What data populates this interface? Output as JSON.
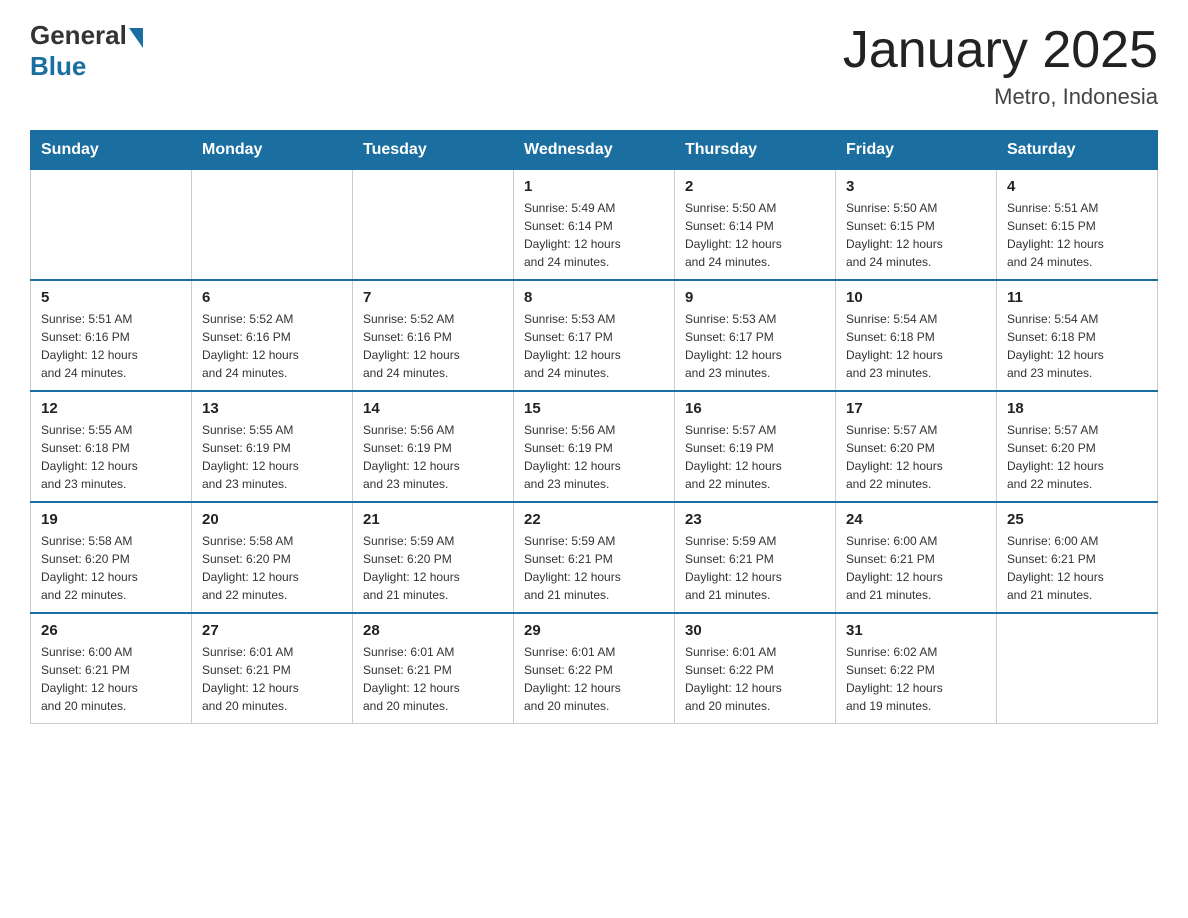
{
  "header": {
    "title": "January 2025",
    "location": "Metro, Indonesia"
  },
  "logo": {
    "general": "General",
    "blue": "Blue"
  },
  "days": [
    "Sunday",
    "Monday",
    "Tuesday",
    "Wednesday",
    "Thursday",
    "Friday",
    "Saturday"
  ],
  "weeks": [
    [
      {
        "num": "",
        "info": ""
      },
      {
        "num": "",
        "info": ""
      },
      {
        "num": "",
        "info": ""
      },
      {
        "num": "1",
        "info": "Sunrise: 5:49 AM\nSunset: 6:14 PM\nDaylight: 12 hours\nand 24 minutes."
      },
      {
        "num": "2",
        "info": "Sunrise: 5:50 AM\nSunset: 6:14 PM\nDaylight: 12 hours\nand 24 minutes."
      },
      {
        "num": "3",
        "info": "Sunrise: 5:50 AM\nSunset: 6:15 PM\nDaylight: 12 hours\nand 24 minutes."
      },
      {
        "num": "4",
        "info": "Sunrise: 5:51 AM\nSunset: 6:15 PM\nDaylight: 12 hours\nand 24 minutes."
      }
    ],
    [
      {
        "num": "5",
        "info": "Sunrise: 5:51 AM\nSunset: 6:16 PM\nDaylight: 12 hours\nand 24 minutes."
      },
      {
        "num": "6",
        "info": "Sunrise: 5:52 AM\nSunset: 6:16 PM\nDaylight: 12 hours\nand 24 minutes."
      },
      {
        "num": "7",
        "info": "Sunrise: 5:52 AM\nSunset: 6:16 PM\nDaylight: 12 hours\nand 24 minutes."
      },
      {
        "num": "8",
        "info": "Sunrise: 5:53 AM\nSunset: 6:17 PM\nDaylight: 12 hours\nand 24 minutes."
      },
      {
        "num": "9",
        "info": "Sunrise: 5:53 AM\nSunset: 6:17 PM\nDaylight: 12 hours\nand 23 minutes."
      },
      {
        "num": "10",
        "info": "Sunrise: 5:54 AM\nSunset: 6:18 PM\nDaylight: 12 hours\nand 23 minutes."
      },
      {
        "num": "11",
        "info": "Sunrise: 5:54 AM\nSunset: 6:18 PM\nDaylight: 12 hours\nand 23 minutes."
      }
    ],
    [
      {
        "num": "12",
        "info": "Sunrise: 5:55 AM\nSunset: 6:18 PM\nDaylight: 12 hours\nand 23 minutes."
      },
      {
        "num": "13",
        "info": "Sunrise: 5:55 AM\nSunset: 6:19 PM\nDaylight: 12 hours\nand 23 minutes."
      },
      {
        "num": "14",
        "info": "Sunrise: 5:56 AM\nSunset: 6:19 PM\nDaylight: 12 hours\nand 23 minutes."
      },
      {
        "num": "15",
        "info": "Sunrise: 5:56 AM\nSunset: 6:19 PM\nDaylight: 12 hours\nand 23 minutes."
      },
      {
        "num": "16",
        "info": "Sunrise: 5:57 AM\nSunset: 6:19 PM\nDaylight: 12 hours\nand 22 minutes."
      },
      {
        "num": "17",
        "info": "Sunrise: 5:57 AM\nSunset: 6:20 PM\nDaylight: 12 hours\nand 22 minutes."
      },
      {
        "num": "18",
        "info": "Sunrise: 5:57 AM\nSunset: 6:20 PM\nDaylight: 12 hours\nand 22 minutes."
      }
    ],
    [
      {
        "num": "19",
        "info": "Sunrise: 5:58 AM\nSunset: 6:20 PM\nDaylight: 12 hours\nand 22 minutes."
      },
      {
        "num": "20",
        "info": "Sunrise: 5:58 AM\nSunset: 6:20 PM\nDaylight: 12 hours\nand 22 minutes."
      },
      {
        "num": "21",
        "info": "Sunrise: 5:59 AM\nSunset: 6:20 PM\nDaylight: 12 hours\nand 21 minutes."
      },
      {
        "num": "22",
        "info": "Sunrise: 5:59 AM\nSunset: 6:21 PM\nDaylight: 12 hours\nand 21 minutes."
      },
      {
        "num": "23",
        "info": "Sunrise: 5:59 AM\nSunset: 6:21 PM\nDaylight: 12 hours\nand 21 minutes."
      },
      {
        "num": "24",
        "info": "Sunrise: 6:00 AM\nSunset: 6:21 PM\nDaylight: 12 hours\nand 21 minutes."
      },
      {
        "num": "25",
        "info": "Sunrise: 6:00 AM\nSunset: 6:21 PM\nDaylight: 12 hours\nand 21 minutes."
      }
    ],
    [
      {
        "num": "26",
        "info": "Sunrise: 6:00 AM\nSunset: 6:21 PM\nDaylight: 12 hours\nand 20 minutes."
      },
      {
        "num": "27",
        "info": "Sunrise: 6:01 AM\nSunset: 6:21 PM\nDaylight: 12 hours\nand 20 minutes."
      },
      {
        "num": "28",
        "info": "Sunrise: 6:01 AM\nSunset: 6:21 PM\nDaylight: 12 hours\nand 20 minutes."
      },
      {
        "num": "29",
        "info": "Sunrise: 6:01 AM\nSunset: 6:22 PM\nDaylight: 12 hours\nand 20 minutes."
      },
      {
        "num": "30",
        "info": "Sunrise: 6:01 AM\nSunset: 6:22 PM\nDaylight: 12 hours\nand 20 minutes."
      },
      {
        "num": "31",
        "info": "Sunrise: 6:02 AM\nSunset: 6:22 PM\nDaylight: 12 hours\nand 19 minutes."
      },
      {
        "num": "",
        "info": ""
      }
    ]
  ]
}
